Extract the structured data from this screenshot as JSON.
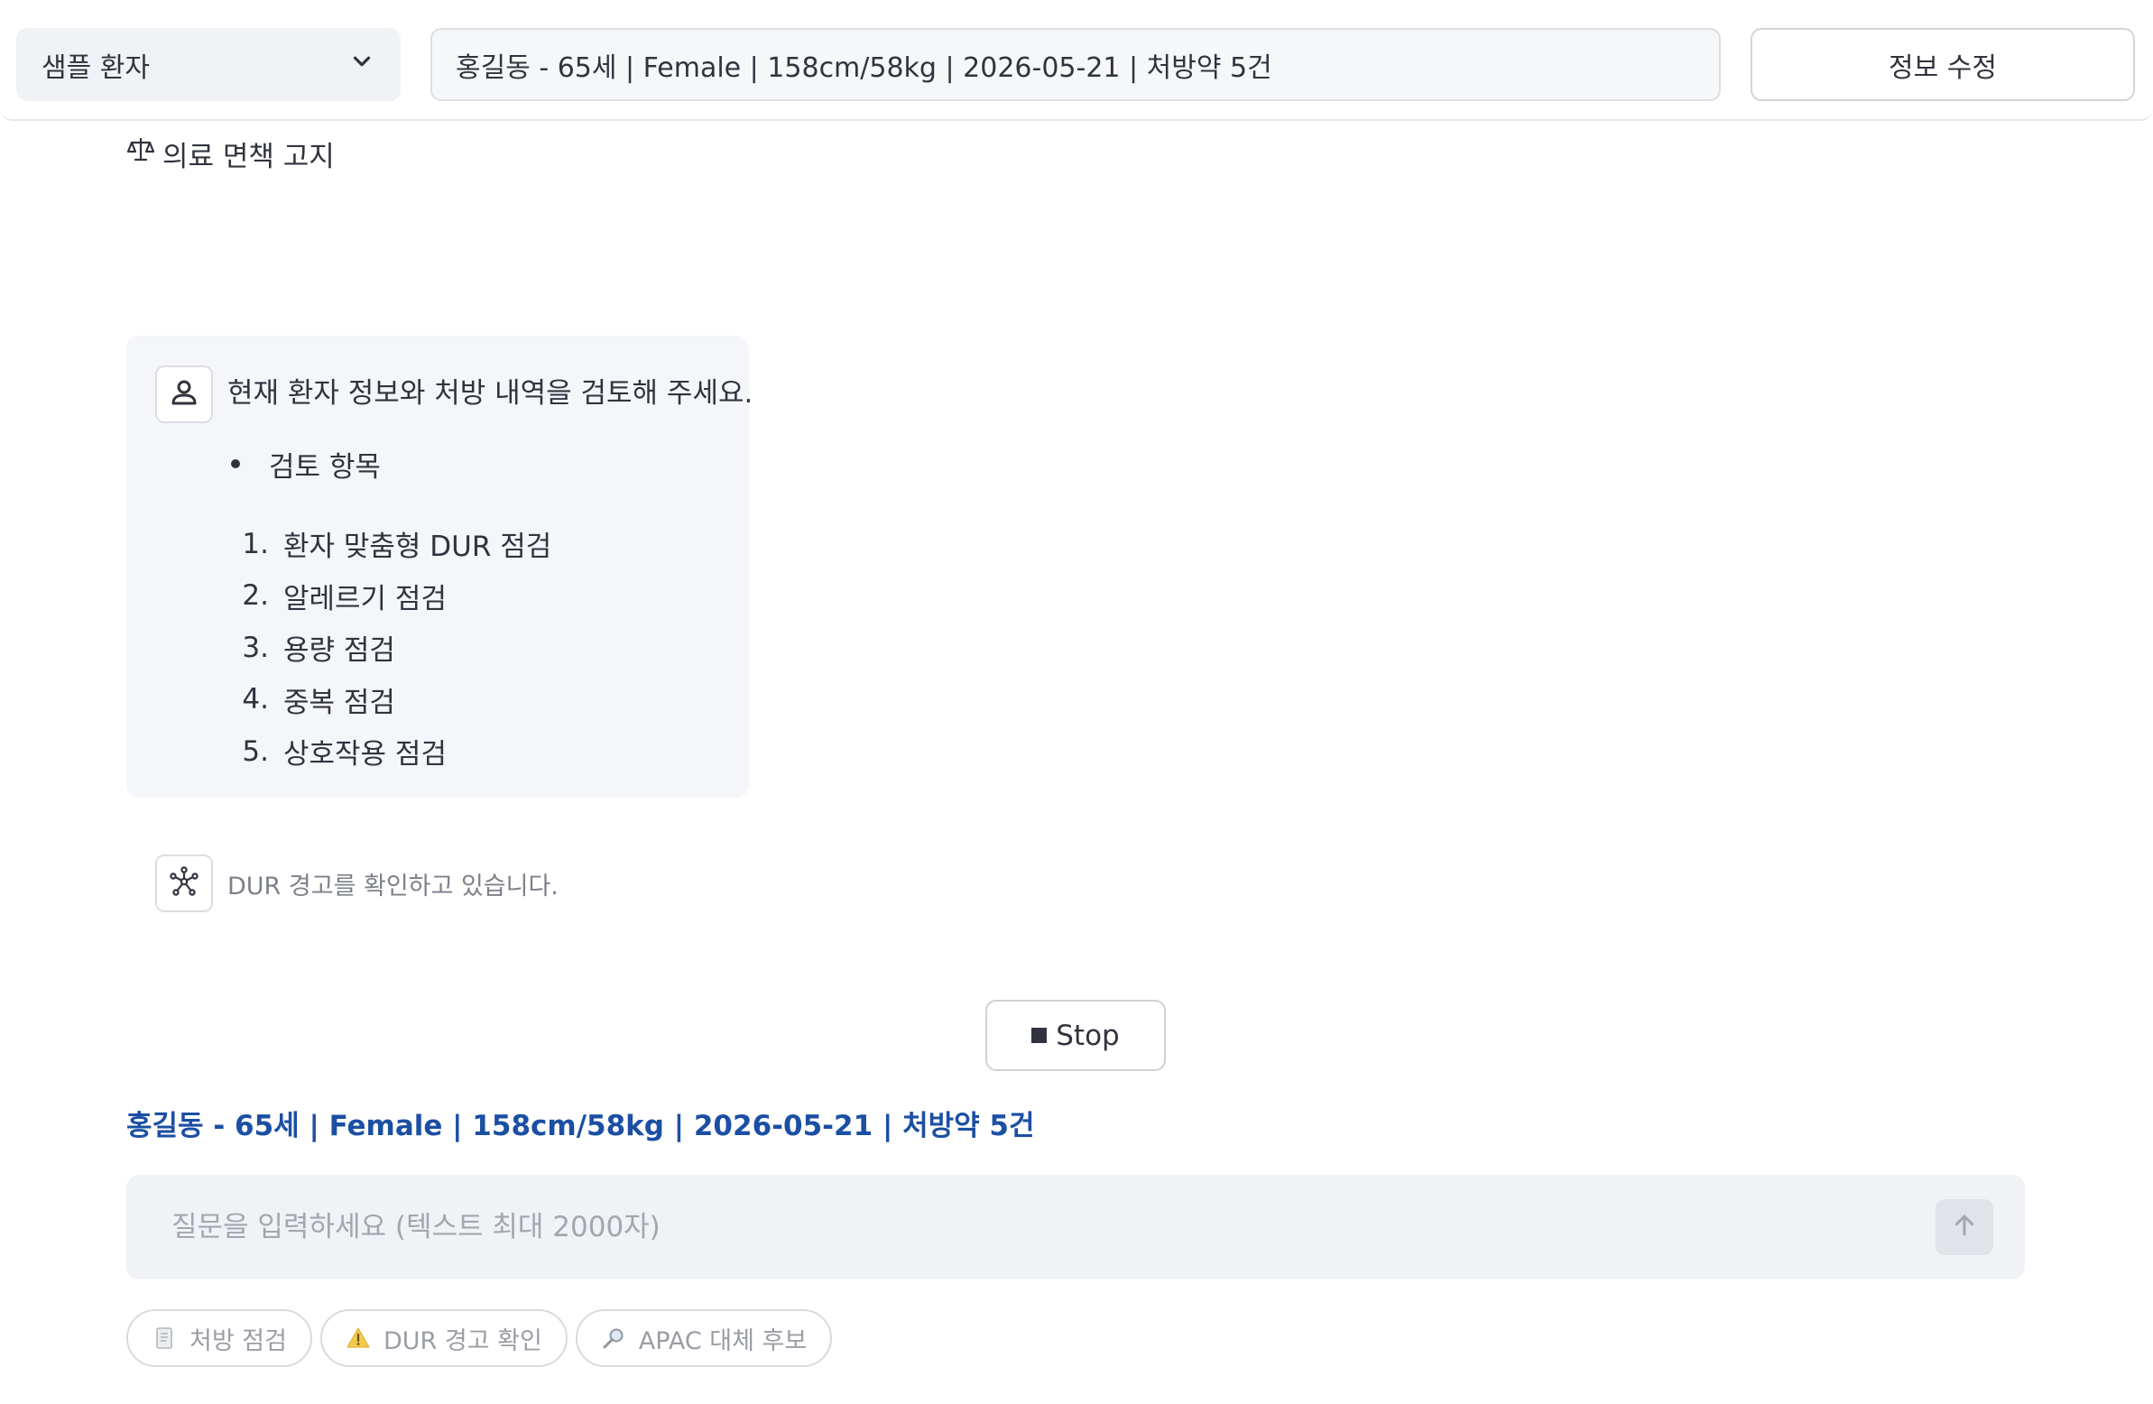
{
  "header": {
    "patient_select": {
      "value": "샘플 환자",
      "icon": "chevron-down-icon"
    },
    "patient_summary": "홍길동 - 65세 | Female | 158cm/58kg | 2026-05-21 | 처방약 5건",
    "edit_button": "정보 수정"
  },
  "disclaimer": {
    "icon": "scales-icon",
    "label": "의료 면책 고지"
  },
  "user_message": {
    "avatar_icon": "user-icon",
    "text": "현재 환자 정보와 처방 내역을 검토해 주세요.",
    "bullet": "검토 항목",
    "items": [
      {
        "num": "1.",
        "label": "환자 맞춤형 DUR 점검"
      },
      {
        "num": "2.",
        "label": "알레르기 점검"
      },
      {
        "num": "3.",
        "label": "용량 점검"
      },
      {
        "num": "4.",
        "label": "중복 점검"
      },
      {
        "num": "5.",
        "label": "상호작용 점검"
      }
    ]
  },
  "assistant": {
    "avatar_icon": "network-icon",
    "status": "DUR 경고를 확인하고 있습니다."
  },
  "stop_button": "Stop",
  "patient_caption": "홍길동 - 65세 | Female | 158cm/58kg | 2026-05-21 | 처방약 5건",
  "chat_input": {
    "placeholder": "질문을 입력하세요 (텍스트 최대 2000자)",
    "value": "",
    "send_icon": "arrow-up-icon"
  },
  "chips": [
    {
      "icon": "document-icon",
      "label": "처방 점검"
    },
    {
      "icon": "warning-icon",
      "label": "DUR 경고 확인"
    },
    {
      "icon": "magnifier-icon",
      "label": "APAC 대체 후보"
    }
  ],
  "colors": {
    "accent_text": "#1b4fa3",
    "input_bg": "#f0f2f6",
    "message_bg": "#f5f6f9",
    "warning": "#f2c94c"
  }
}
